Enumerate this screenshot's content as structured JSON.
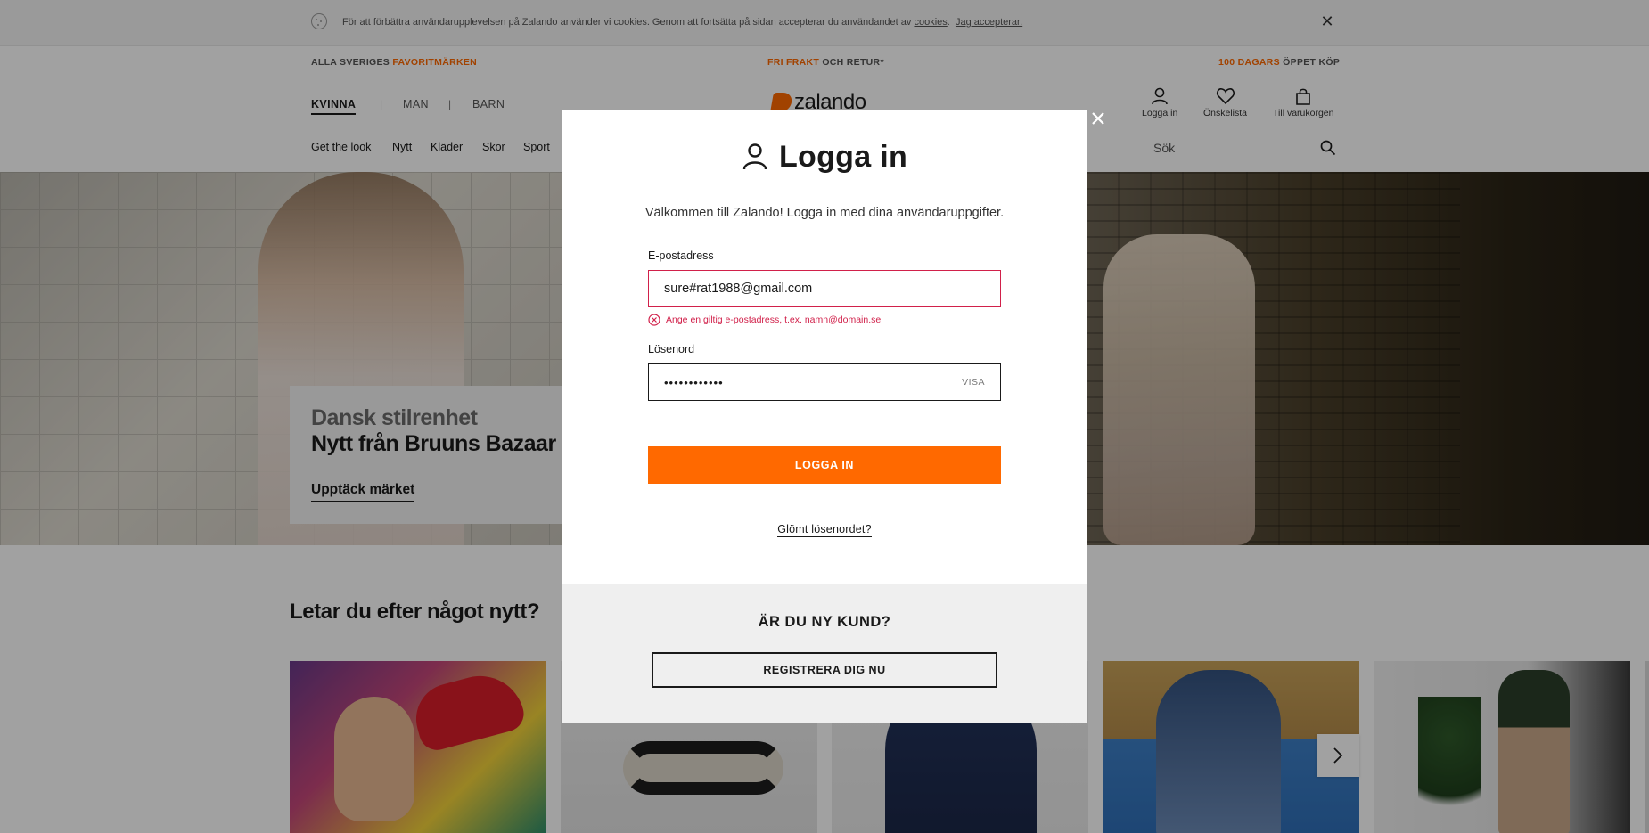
{
  "cookie_bar": {
    "text": "För att förbättra användarupplevelsen på Zalando använder vi cookies. Genom att fortsätta på sidan accepterar du användandet av ",
    "cookies_link": "cookies",
    "separator": ".",
    "accept_link": "Jag accepterar."
  },
  "promos": [
    {
      "plain": "ALLA SVERIGES ",
      "highlight": "FAVORITMÄRKEN",
      "suffix": ""
    },
    {
      "plain": "",
      "highlight": "FRI FRAKT",
      "suffix": " OCH RETUR*"
    },
    {
      "plain": "",
      "highlight": "100 DAGARS",
      "suffix": " ÖPPET KÖP"
    }
  ],
  "gender_tabs": [
    "KVINNA",
    "MAN",
    "BARN"
  ],
  "gender_separator": "|",
  "logo_text": "zalando",
  "utility": {
    "login": "Logga in",
    "wishlist": "Önskelista",
    "cart": "Till varukorgen"
  },
  "categories": [
    "Get the look",
    "Nytt",
    "Kläder",
    "Skor",
    "Sport"
  ],
  "search": {
    "placeholder": "Sök"
  },
  "hero": {
    "subtitle": "Dansk stilrenhet",
    "title": "Nytt från Bruuns Bazaar",
    "cta": "Upptäck märket"
  },
  "section_title": "Letar du efter något nytt?",
  "modal": {
    "title": "Logga in",
    "welcome": "Välkommen till Zalando! Logga in med dina användaruppgifter.",
    "email_label": "E-postadress",
    "email_value": "sure#rat1988@gmail.com",
    "email_error": "Ange en giltig e-postadress, t.ex. namn@domain.se",
    "password_label": "Lösenord",
    "password_value": "••••••••••••",
    "show_password": "VISA",
    "login_button": "LOGGA IN",
    "forgot_link": "Glömt lösenordet?",
    "new_customer_title": "ÄR DU NY KUND?",
    "register_button": "REGISTRERA DIG NU"
  },
  "colors": {
    "accent": "#ff6900",
    "error": "#d1204a",
    "overlay": "rgba(0,0,0,0.37)"
  }
}
